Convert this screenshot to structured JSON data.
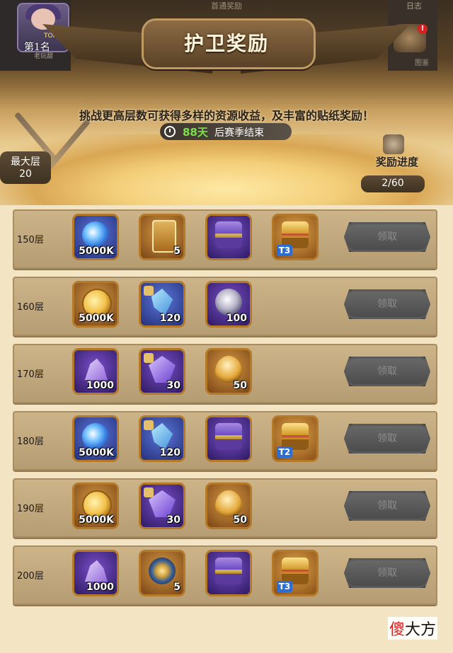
{
  "header": {
    "top_tab_label": "首通奖励",
    "right_tab_label": "日志",
    "right_sub_label": "图鉴",
    "alert": "!",
    "rank_top": "TOP 1",
    "rank": "第1名",
    "avatar_sub": "老玩甜",
    "title": "护卫奖励"
  },
  "info": {
    "subtitle": "挑战更高层数可获得多样的资源收益，及丰富的贴纸奖励！",
    "season_days": "88天",
    "season_rest": "后赛季结束",
    "max_floor_label": "最大层",
    "max_floor_value": "20",
    "progress_label": "奖励进度",
    "progress_value": "2/60"
  },
  "rows": [
    {
      "floor": "150层",
      "button": "领取",
      "items": [
        {
          "icon": "swirl-icon",
          "qty": "5000K",
          "tier": ""
        },
        {
          "icon": "card-icon",
          "qty": "5",
          "tier": ""
        },
        {
          "icon": "chest-icon",
          "qty": "",
          "tier": ""
        },
        {
          "icon": "gold-chest-icon",
          "qty": "",
          "tier": "T3"
        }
      ]
    },
    {
      "floor": "160层",
      "button": "领取",
      "items": [
        {
          "icon": "coin-icon",
          "qty": "5000K",
          "tier": ""
        },
        {
          "icon": "crystal-icon",
          "qty": "120",
          "tier": ""
        },
        {
          "icon": "gem-icon",
          "qty": "100",
          "tier": ""
        }
      ]
    },
    {
      "floor": "170层",
      "button": "领取",
      "items": [
        {
          "icon": "ore-icon",
          "qty": "1000",
          "tier": ""
        },
        {
          "icon": "shard-icon",
          "qty": "30",
          "tier": ""
        },
        {
          "icon": "seed-icon",
          "qty": "50",
          "tier": ""
        }
      ]
    },
    {
      "floor": "180层",
      "button": "领取",
      "items": [
        {
          "icon": "swirl-icon",
          "qty": "5000K",
          "tier": ""
        },
        {
          "icon": "crystal-icon",
          "qty": "120",
          "tier": ""
        },
        {
          "icon": "chest-icon",
          "qty": "",
          "tier": ""
        },
        {
          "icon": "gold-chest-icon",
          "qty": "",
          "tier": "T2"
        }
      ]
    },
    {
      "floor": "190层",
      "button": "领取",
      "items": [
        {
          "icon": "coin-icon",
          "qty": "5000K",
          "tier": ""
        },
        {
          "icon": "shard-icon",
          "qty": "30",
          "tier": ""
        },
        {
          "icon": "seed-icon",
          "qty": "50",
          "tier": ""
        }
      ]
    },
    {
      "floor": "200层",
      "button": "领取",
      "items": [
        {
          "icon": "ore-icon",
          "qty": "1000",
          "tier": ""
        },
        {
          "icon": "compass-icon",
          "qty": "5",
          "tier": ""
        },
        {
          "icon": "chest-icon",
          "qty": "",
          "tier": ""
        },
        {
          "icon": "gold-chest-icon",
          "qty": "",
          "tier": "T3"
        }
      ]
    }
  ],
  "watermark": {
    "first": "傻",
    "rest": "大方"
  }
}
